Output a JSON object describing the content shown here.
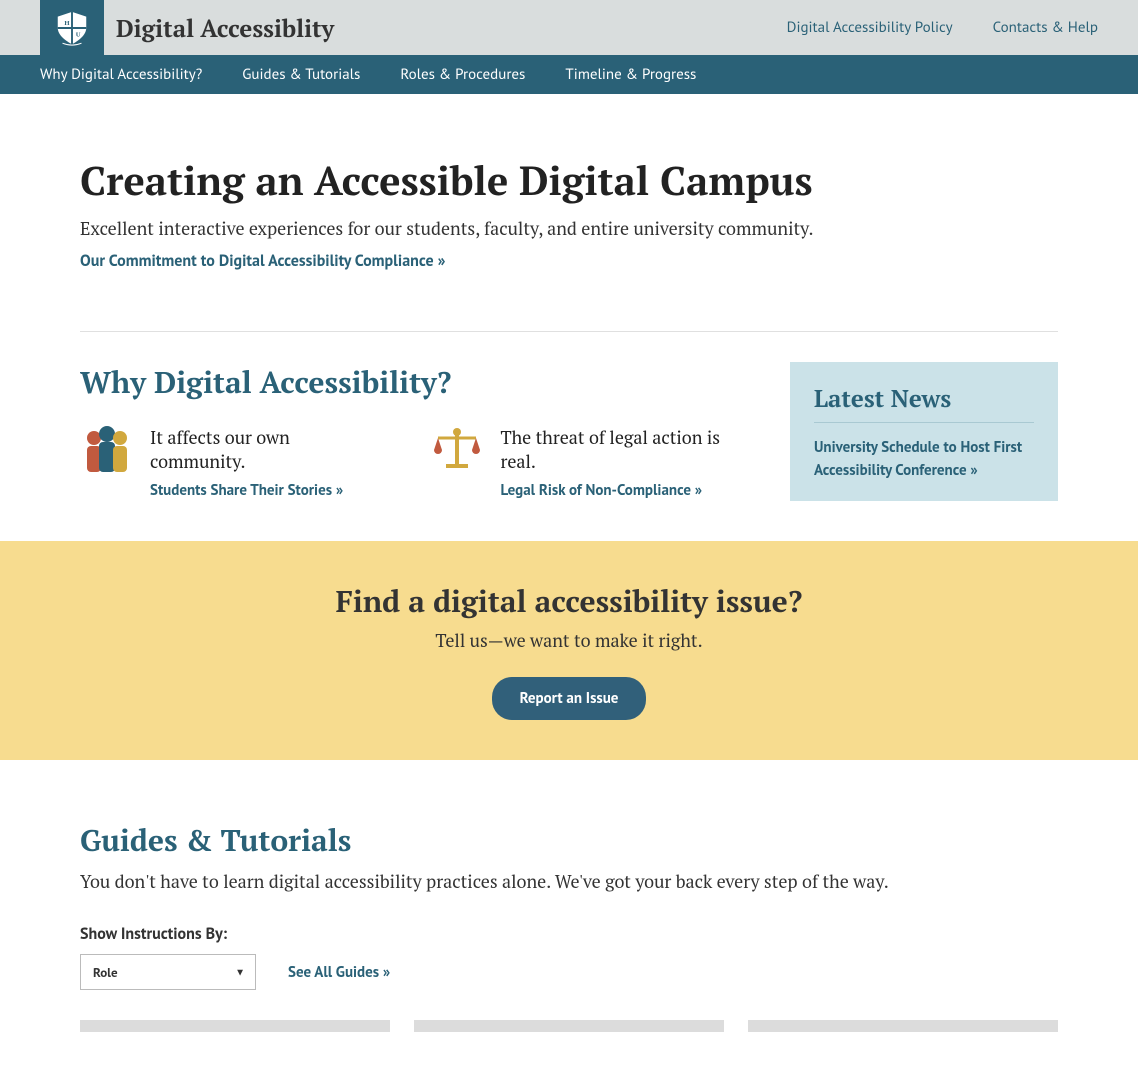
{
  "header": {
    "site_title": "Digital Accessiblity",
    "top_links": [
      "Digital Accessibility Policy",
      "Contacts & Help"
    ]
  },
  "nav": [
    "Why Digital Accessibility?",
    "Guides & Tutorials",
    "Roles & Procedures",
    "Timeline & Progress"
  ],
  "hero": {
    "title": "Creating an Accessible Digital Campus",
    "subtitle": "Excellent interactive experiences for our students, faculty, and entire university community.",
    "commitment_link": "Our Commitment to Digital Accessibility Compliance »"
  },
  "why": {
    "heading": "Why Digital Accessibility?",
    "reasons": [
      {
        "title": "It affects our own community.",
        "link": "Students Share Their Stories »"
      },
      {
        "title": "The threat of legal action is real.",
        "link": "Legal Risk of Non-Compliance »"
      }
    ]
  },
  "news": {
    "heading": "Latest News",
    "link": "University Schedule to Host First Accessibility Conference »"
  },
  "issue_banner": {
    "heading": "Find a digital accessibility issue?",
    "subtitle": "Tell us—we want to make it right.",
    "button": "Report an Issue"
  },
  "guides": {
    "heading": "Guides & Tutorials",
    "subtitle": "You don't have to learn digital accessibility practices alone. We've got your back every step of the way.",
    "filter_label": "Show Instructions By:",
    "select_value": "Role",
    "see_all": "See All Guides  »"
  }
}
